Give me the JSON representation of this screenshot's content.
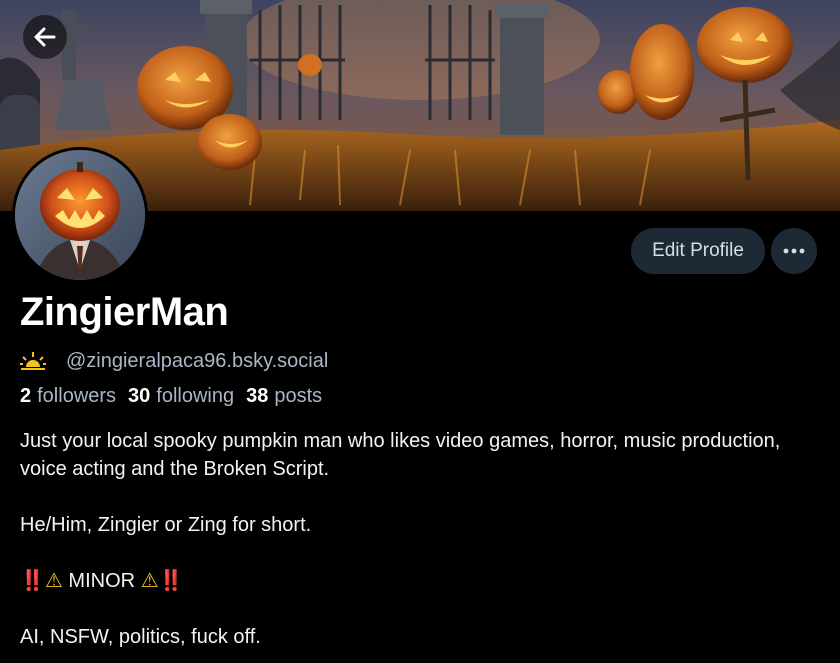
{
  "profile": {
    "display_name": "ZingierMan",
    "handle": "@zingieralpaca96.bsky.social",
    "handle_badge_icon": "sunrise-icon"
  },
  "stats": {
    "followers_count": "2",
    "followers_label": "followers",
    "following_count": "30",
    "following_label": "following",
    "posts_count": "38",
    "posts_label": "posts"
  },
  "actions": {
    "edit_profile_label": "Edit Profile",
    "back_icon": "arrow-left-icon",
    "more_icon": "ellipsis-icon"
  },
  "bio": {
    "line1": "Just your local spooky pumpkin man who likes video games, horror, music production, voice acting and the Broken Script.",
    "line2": "He/Him, Zingier or Zing for short.",
    "minor_prefix": "‼️",
    "minor_text": "MINOR",
    "minor_suffix": "‼️",
    "line4": "AI, NSFW, politics, fuck off."
  },
  "colors": {
    "background": "#000000",
    "button_bg": "#1e2936",
    "muted_text": "#a9b6c6",
    "alert_red": "#e0302a",
    "warning_yellow": "#f2c31b"
  }
}
